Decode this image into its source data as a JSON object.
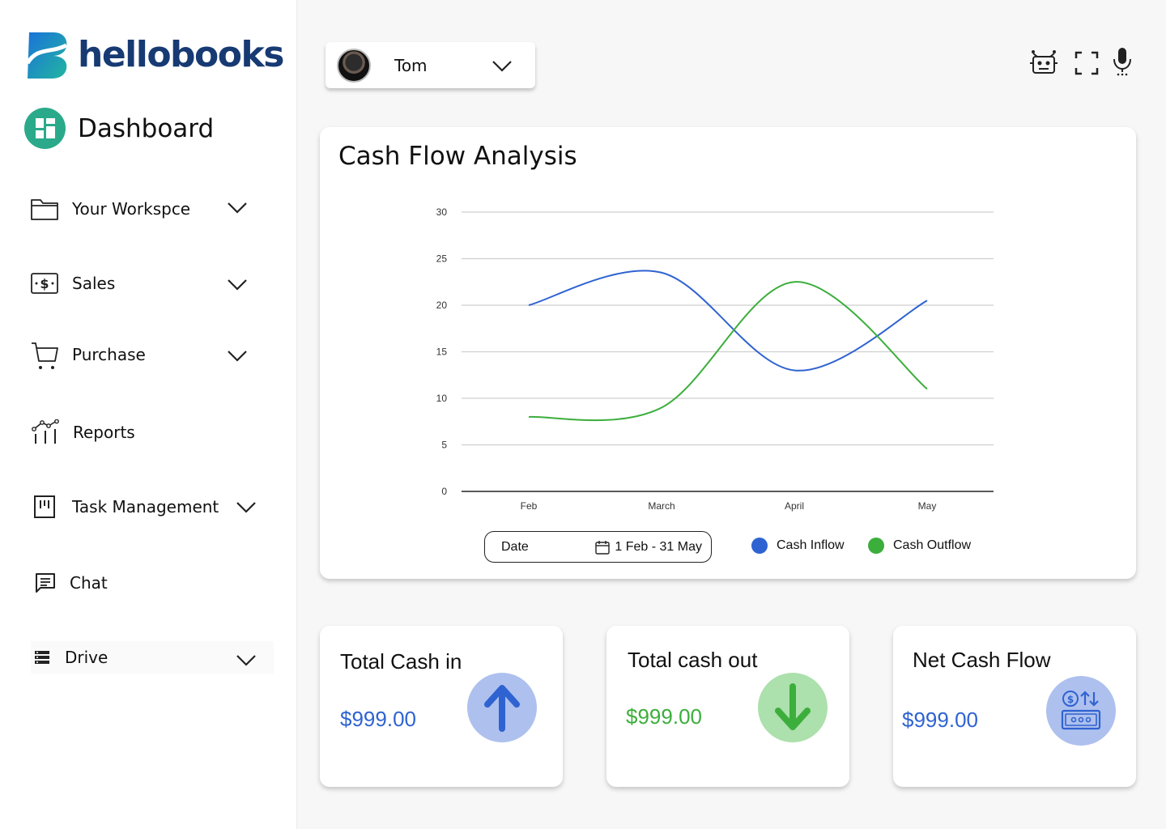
{
  "brand": {
    "name": "hellobooks",
    "color": "#173a73"
  },
  "sidebar": {
    "dashboard_label": "Dashboard",
    "items": [
      {
        "label": "Your Workspce",
        "icon": "folder-icon",
        "has_dropdown": true
      },
      {
        "label": "Sales",
        "icon": "cash-icon",
        "has_dropdown": true
      },
      {
        "label": "Purchase",
        "icon": "cart-icon",
        "has_dropdown": true
      },
      {
        "label": "Reports",
        "icon": "reports-icon",
        "has_dropdown": false
      },
      {
        "label": "Task Management",
        "icon": "task-icon",
        "has_dropdown": true
      },
      {
        "label": "Chat",
        "icon": "chat-icon",
        "has_dropdown": false
      },
      {
        "label": "Drive",
        "icon": "drive-icon",
        "has_dropdown": true
      }
    ]
  },
  "header": {
    "user": {
      "name": "Tom",
      "avatar_icon": "avatar"
    },
    "icons": [
      "robot-icon",
      "fullscreen-icon",
      "microphone-icon"
    ]
  },
  "cash_flow": {
    "title": "Cash Flow Analysis",
    "date_label": "Date",
    "date_range": "1 Feb - 31 May",
    "legend": [
      {
        "name": "Cash Inflow",
        "color": "#2f63d1"
      },
      {
        "name": "Cash Outflow",
        "color": "#3cae3c"
      }
    ]
  },
  "chart_data": {
    "type": "line",
    "categories": [
      "Feb",
      "March",
      "April",
      "May"
    ],
    "series": [
      {
        "name": "Cash Inflow",
        "values": [
          20,
          23.5,
          13,
          20.5
        ]
      },
      {
        "name": "Cash Outflow",
        "values": [
          8,
          9,
          22.5,
          11
        ]
      }
    ],
    "ylim": [
      0,
      30
    ],
    "yticks": [
      0,
      5,
      10,
      15,
      20,
      25,
      30
    ],
    "grid": true,
    "legend_position": "bottom"
  },
  "stats": [
    {
      "title": "Total Cash in",
      "value": "$999.00",
      "value_color": "#2f63d1",
      "circle_color": "#aec0ee",
      "icon": "arrow-up-icon"
    },
    {
      "title": "Total cash out",
      "value": "$999.00",
      "value_color": "#3cae3c",
      "circle_color": "#ace0ac",
      "icon": "arrow-down-icon"
    },
    {
      "title": "Net Cash Flow",
      "value": "$999.00",
      "value_color": "#2f63d1",
      "circle_color": "#aec0ee",
      "icon": "money-exchange-icon"
    }
  ]
}
